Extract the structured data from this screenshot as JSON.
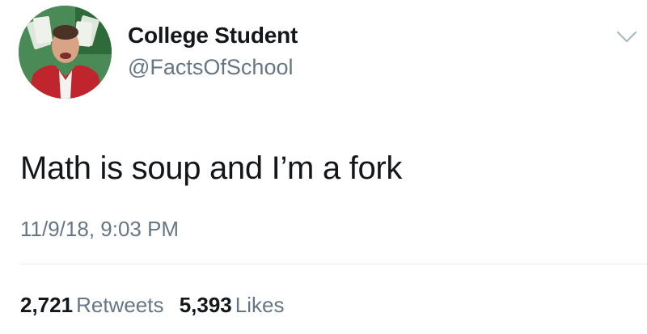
{
  "user": {
    "display_name": "College Student",
    "handle": "@FactsOfSchool"
  },
  "tweet": {
    "text": "Math is soup and I’m a fork",
    "timestamp": "11/9/18, 9:03 PM"
  },
  "stats": {
    "retweets_count": "2,721",
    "retweets_label": "Retweets",
    "likes_count": "5,393",
    "likes_label": "Likes"
  },
  "icons": {
    "menu": "chevron-down-icon"
  },
  "colors": {
    "primary_text": "#14171a",
    "secondary_text": "#657786",
    "divider": "#e6ecf0"
  }
}
